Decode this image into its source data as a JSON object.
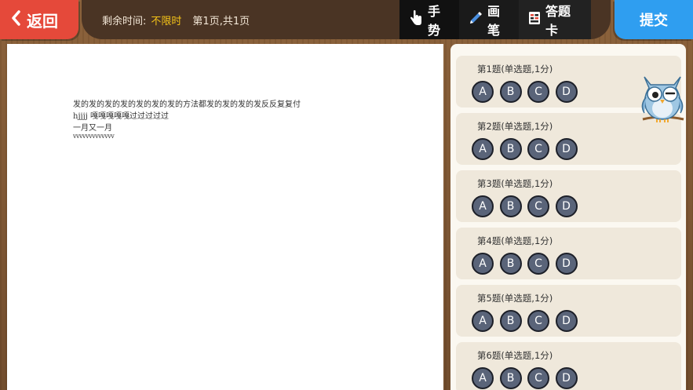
{
  "header": {
    "back_label": "返回",
    "time_label": "剩余时间:",
    "time_value": "不限时",
    "page_prefix": "第",
    "page_current": "1",
    "page_mid": "页,共",
    "page_total": "1",
    "page_suffix": "页",
    "tools": [
      {
        "label": "手势",
        "icon": "hand-pointer-icon"
      },
      {
        "label": "画笔",
        "icon": "pen-icon"
      },
      {
        "label": "答题卡",
        "icon": "answer-card-icon"
      }
    ],
    "submit_label": "提交"
  },
  "document": {
    "lines": [
      "发的发的发的发的发的发的发的方法都发的发的发的发反反复复付",
      "hjjjj 嘎嘎嘎嘎嘎过过过过过",
      "一月又一月",
      "vvvvvvvvvvvvv"
    ]
  },
  "answer_card": {
    "questions": [
      {
        "title": "第1题(单选题,1分)",
        "options": [
          "A",
          "B",
          "C",
          "D"
        ]
      },
      {
        "title": "第2题(单选题,1分)",
        "options": [
          "A",
          "B",
          "C",
          "D"
        ]
      },
      {
        "title": "第3题(单选题,1分)",
        "options": [
          "A",
          "B",
          "C",
          "D"
        ]
      },
      {
        "title": "第4题(单选题,1分)",
        "options": [
          "A",
          "B",
          "C",
          "D"
        ]
      },
      {
        "title": "第5题(单选题,1分)",
        "options": [
          "A",
          "B",
          "C",
          "D"
        ]
      },
      {
        "title": "第6题(单选题,1分)",
        "options": [
          "A",
          "B",
          "C",
          "D"
        ]
      }
    ]
  },
  "colors": {
    "back_button": "#e5493a",
    "submit_button": "#2f9ef0",
    "highlight_text": "#f4c318",
    "option_fill": "#5a6479"
  }
}
